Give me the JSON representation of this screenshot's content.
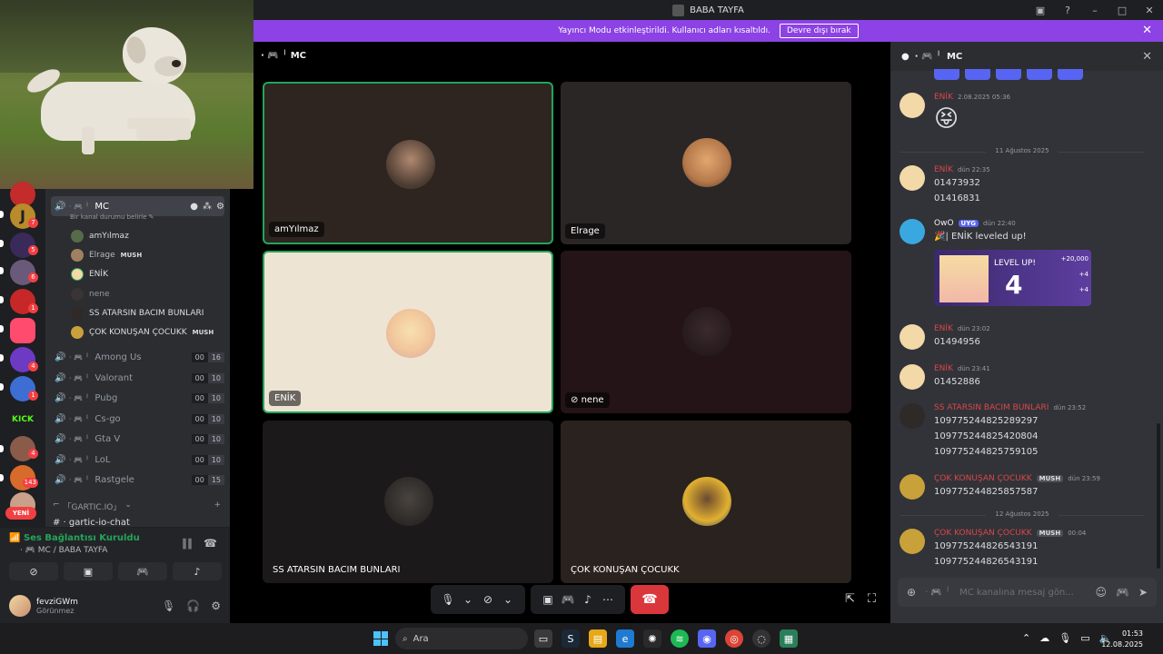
{
  "window": {
    "title": "BABA TAYFA"
  },
  "notice": {
    "text": "Yayıncı Modu etkinleştirildi. Kullanıcı adları kısaltıldı.",
    "button": "Devre dışı bırak"
  },
  "channel": {
    "name": "MC",
    "status_hint": "Bir kanal durumu belirle"
  },
  "sidebar": {
    "members": [
      {
        "name": "amYılmaz",
        "badge": ""
      },
      {
        "name": "Elrage",
        "badge": "MUSH"
      },
      {
        "name": "ENİK",
        "badge": ""
      },
      {
        "name": "nene",
        "badge": ""
      },
      {
        "name": "SS ATARSIN BACIM BUNLARI",
        "badge": ""
      },
      {
        "name": "ÇOK KONUŞAN ÇOCUKK",
        "badge": "MUSH"
      }
    ],
    "voice_channels": [
      {
        "name": "Among Us",
        "count": "00",
        "limit": "16"
      },
      {
        "name": "Valorant",
        "count": "00",
        "limit": "10"
      },
      {
        "name": "Pubg",
        "count": "00",
        "limit": "10"
      },
      {
        "name": "Cs-go",
        "count": "00",
        "limit": "10"
      },
      {
        "name": "Gta V",
        "count": "00",
        "limit": "10"
      },
      {
        "name": "LoL",
        "count": "00",
        "limit": "10"
      },
      {
        "name": "Rastgele",
        "count": "00",
        "limit": "15"
      }
    ],
    "category": "「GARTIC.IO」",
    "partial_channel": "gartic-io-chat"
  },
  "rail": {
    "badges": [
      "7",
      "6",
      "5",
      "1",
      "4",
      "1",
      "4",
      "143"
    ],
    "new_label": "YENİ",
    "kick_label": "KICK"
  },
  "voice_panel": {
    "status": "Ses Bağlantısı Kuruldu",
    "location": "MC / BABA TAYFA"
  },
  "user": {
    "name": "fevziGWm",
    "status": "Görünmez"
  },
  "stage": {
    "tiles": [
      {
        "name": "amYılmaz"
      },
      {
        "name": "Elrage"
      },
      {
        "name": "ENİK"
      },
      {
        "name": "nene"
      },
      {
        "name": "SS ATARSIN BACIM BUNLARI"
      },
      {
        "name": "ÇOK KONUŞAN ÇOCUKK"
      }
    ]
  },
  "chat": {
    "header": "MC",
    "input_placeholder": "MC kanalına mesaj gön...",
    "msg1": {
      "author": "ENİK",
      "time": "2.08.2025 05:36"
    },
    "divider1": "11 Ağustos 2025",
    "msg2": {
      "author": "ENİK",
      "time": "dün 22:35",
      "lines": [
        "01473932",
        "01416831"
      ]
    },
    "msg3": {
      "author": "OwO",
      "badge": "UYG",
      "time": "dün 22:40",
      "text": "| ENİK leveled up!",
      "card": {
        "title": "LEVEL UP!",
        "level": "4",
        "rewards": [
          "+20,000",
          "+4",
          "+4"
        ]
      }
    },
    "msg4": {
      "author": "ENİK",
      "time": "dün 23:02",
      "line": "01494956"
    },
    "msg5": {
      "author": "ENİK",
      "time": "dün 23:41",
      "line": "01452886"
    },
    "msg6": {
      "author": "SS ATARSIN BACIM BUNLARI",
      "time": "dün 23:52",
      "lines": [
        "109775244825289297",
        "109775244825420804",
        "109775244825759105"
      ]
    },
    "msg7": {
      "author": "ÇOK KONUŞAN ÇOCUKK",
      "badge": "MUSH",
      "time": "dün 23:59",
      "line": "109775244825857587"
    },
    "divider2": "12 Ağustos 2025",
    "msg8": {
      "author": "ÇOK KONUŞAN ÇOCUKK",
      "badge": "MUSH",
      "time": "00:04",
      "lines": [
        "109775244826543191",
        "109775244826543191"
      ]
    }
  },
  "taskbar": {
    "search": "Ara",
    "time": "01:53",
    "date": "12.08.2025"
  }
}
